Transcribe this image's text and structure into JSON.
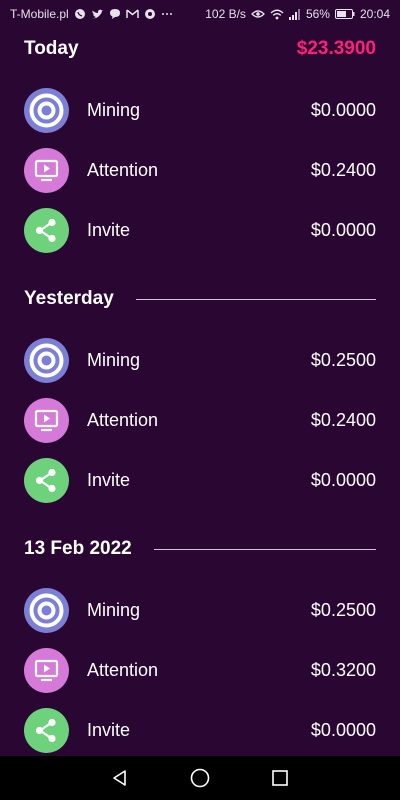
{
  "status_bar": {
    "carrier": "T-Mobile.pl",
    "speed": "102 B/s",
    "battery": "56%",
    "time": "20:04",
    "icons": [
      "whatsapp-icon",
      "twitter-icon",
      "chat-icon",
      "gmail-icon",
      "chrome-icon",
      "more-icon",
      "speed-label",
      "eye-icon",
      "wifi-icon",
      "signal-icon",
      "battery-icon"
    ]
  },
  "colors": {
    "background": "#2a0633",
    "total_accent": "#ff1f7a",
    "mining": "#7b7fd6",
    "attention": "#d57ad8",
    "invite": "#6ed17c"
  },
  "sections": [
    {
      "title": "Today",
      "total": "$23.3900",
      "rows": [
        {
          "label": "Mining",
          "amount": "$0.0000",
          "icon": "mining-icon"
        },
        {
          "label": "Attention",
          "amount": "$0.2400",
          "icon": "attention-icon"
        },
        {
          "label": "Invite",
          "amount": "$0.0000",
          "icon": "share-icon"
        }
      ]
    },
    {
      "title": "Yesterday",
      "rows": [
        {
          "label": "Mining",
          "amount": "$0.2500",
          "icon": "mining-icon"
        },
        {
          "label": "Attention",
          "amount": "$0.2400",
          "icon": "attention-icon"
        },
        {
          "label": "Invite",
          "amount": "$0.0000",
          "icon": "share-icon"
        }
      ]
    },
    {
      "title": "13 Feb 2022",
      "rows": [
        {
          "label": "Mining",
          "amount": "$0.2500",
          "icon": "mining-icon"
        },
        {
          "label": "Attention",
          "amount": "$0.3200",
          "icon": "attention-icon"
        },
        {
          "label": "Invite",
          "amount": "$0.0000",
          "icon": "share-icon"
        }
      ]
    }
  ],
  "nav_bar": {
    "icons": [
      "back-icon",
      "home-icon",
      "recents-icon"
    ]
  }
}
